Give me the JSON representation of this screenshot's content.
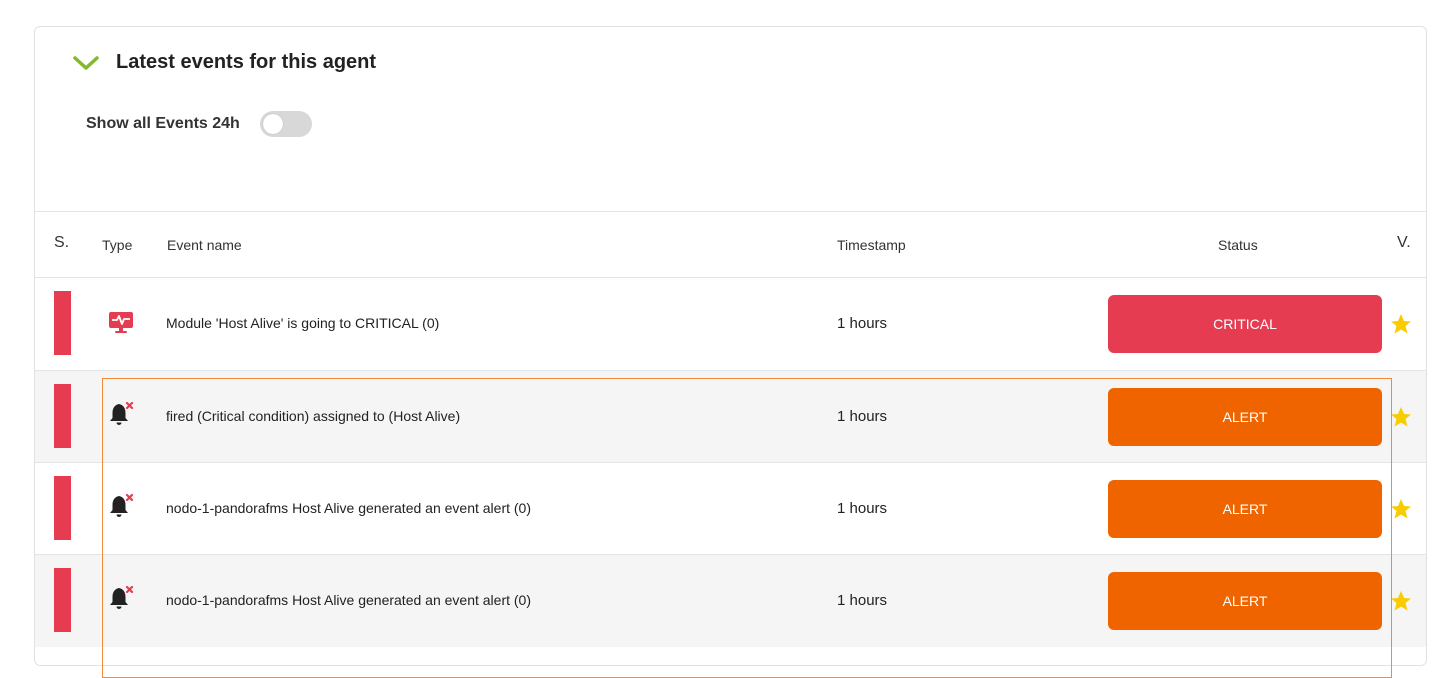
{
  "panel": {
    "title": "Latest events for this agent",
    "toggle_label": "Show all Events 24h",
    "toggle_state": "off",
    "accent_color": "#82b92e"
  },
  "table": {
    "headers": {
      "severity": "S.",
      "type": "Type",
      "event_name": "Event name",
      "timestamp": "Timestamp",
      "status": "Status",
      "validated": "V."
    },
    "rows": [
      {
        "type_icon": "monitor-critical-icon",
        "name": "Module 'Host Alive' is going to CRITICAL (0)",
        "timestamp": "1 hours",
        "status": "CRITICAL",
        "status_color": "#e63c52",
        "severity_color": "#e63c52"
      },
      {
        "type_icon": "bell-alert-icon",
        "name": "fired (Critical condition) assigned to (Host Alive)",
        "timestamp": "1 hours",
        "status": "ALERT",
        "status_color": "#f06400",
        "severity_color": "#e63c52"
      },
      {
        "type_icon": "bell-alert-icon",
        "name": "nodo-1-pandorafms Host Alive generated an event alert (0)",
        "timestamp": "1 hours",
        "status": "ALERT",
        "status_color": "#f06400",
        "severity_color": "#e63c52"
      },
      {
        "type_icon": "bell-alert-icon",
        "name": "nodo-1-pandorafms Host Alive generated an event alert (0)",
        "timestamp": "1 hours",
        "status": "ALERT",
        "status_color": "#f06400",
        "severity_color": "#e63c52"
      }
    ]
  }
}
